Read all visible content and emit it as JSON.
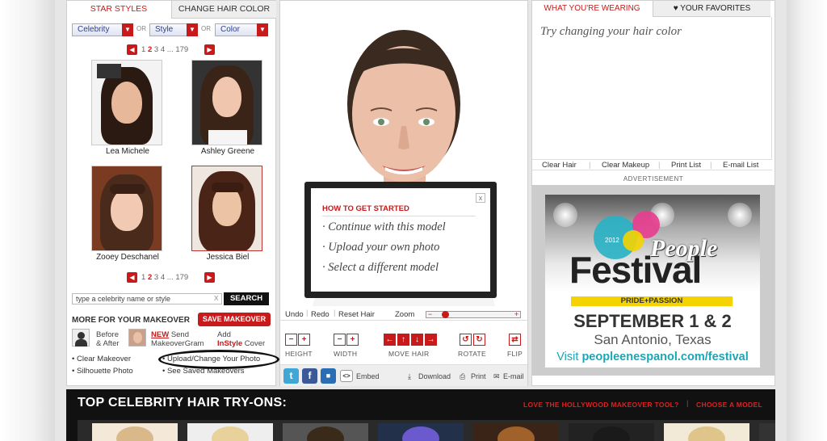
{
  "left": {
    "tabs": {
      "star_styles": "STAR STYLES",
      "change_hair_color": "CHANGE HAIR COLOR"
    },
    "filters": {
      "celebrity": "Celebrity",
      "style": "Style",
      "color": "Color",
      "or": "OR"
    },
    "pager": {
      "pages": [
        "1",
        "2",
        "3",
        "4"
      ],
      "current": "2",
      "ellipsis": "...",
      "last": "179"
    },
    "celebrities": [
      "Lea Michele",
      "Ashley Greene",
      "Zooey Deschanel",
      "Jessica Biel"
    ],
    "search": {
      "placeholder": "type a celebrity name or style",
      "clear": "X",
      "button": "SEARCH"
    },
    "more": {
      "title": "MORE FOR YOUR MAKEOVER",
      "save": "SAVE MAKEOVER",
      "before_after_1": "Before",
      "before_after_2": "& After",
      "new": "NEW",
      "send": "Send",
      "makeovergram": "MakeoverGram",
      "add": "Add",
      "instyle": "InStyle",
      "cover": "Cover",
      "clear_makeover": "Clear Makeover",
      "upload_change": "Upload/Change Your Photo",
      "silhouette": "Silhouette Photo",
      "see_saved": "See Saved Makeovers"
    }
  },
  "center": {
    "popup": {
      "title": "HOW TO GET STARTED",
      "items": [
        "Continue with this model",
        "Upload your own photo",
        "Select a different model"
      ],
      "close": "x"
    },
    "edit": {
      "undo": "Undo",
      "redo": "Redo",
      "reset": "Reset Hair",
      "zoom": "Zoom",
      "zoom_level": 0.1
    },
    "controls": {
      "height": "HEIGHT",
      "width": "WIDTH",
      "move_hair": "MOVE HAIR",
      "rotate": "ROTATE",
      "flip": "FLIP"
    },
    "bottom": {
      "embed": "Embed",
      "download": "Download",
      "print": "Print",
      "email": "E-mail"
    }
  },
  "right": {
    "tabs": {
      "wearing": "WHAT YOU'RE WEARING",
      "favorites": "YOUR FAVORITES"
    },
    "try_text": "Try changing your hair color",
    "links": [
      "Clear Hair",
      "Clear Makeup",
      "Print List",
      "E-mail List"
    ],
    "advertisement": "ADVERTISEMENT",
    "ad": {
      "people": "People",
      "year": "2012",
      "festival": "Festival",
      "band": "PRIDE+PASSION",
      "date": "SEPTEMBER 1 & 2",
      "city": "San Antonio, Texas",
      "visit": "Visit",
      "url": "peopleenespanol.com/festival"
    }
  },
  "strip": {
    "title": "TOP CELEBRITY HAIR TRY-ONS:",
    "love": "LOVE THE HOLLYWOOD MAKEOVER TOOL?",
    "choose": "CHOOSE A MODEL"
  },
  "colors": {
    "accent": "#c81a1a",
    "dark": "#111111",
    "ad_teal": "#19a7b8",
    "ad_yellow": "#f5d300"
  }
}
